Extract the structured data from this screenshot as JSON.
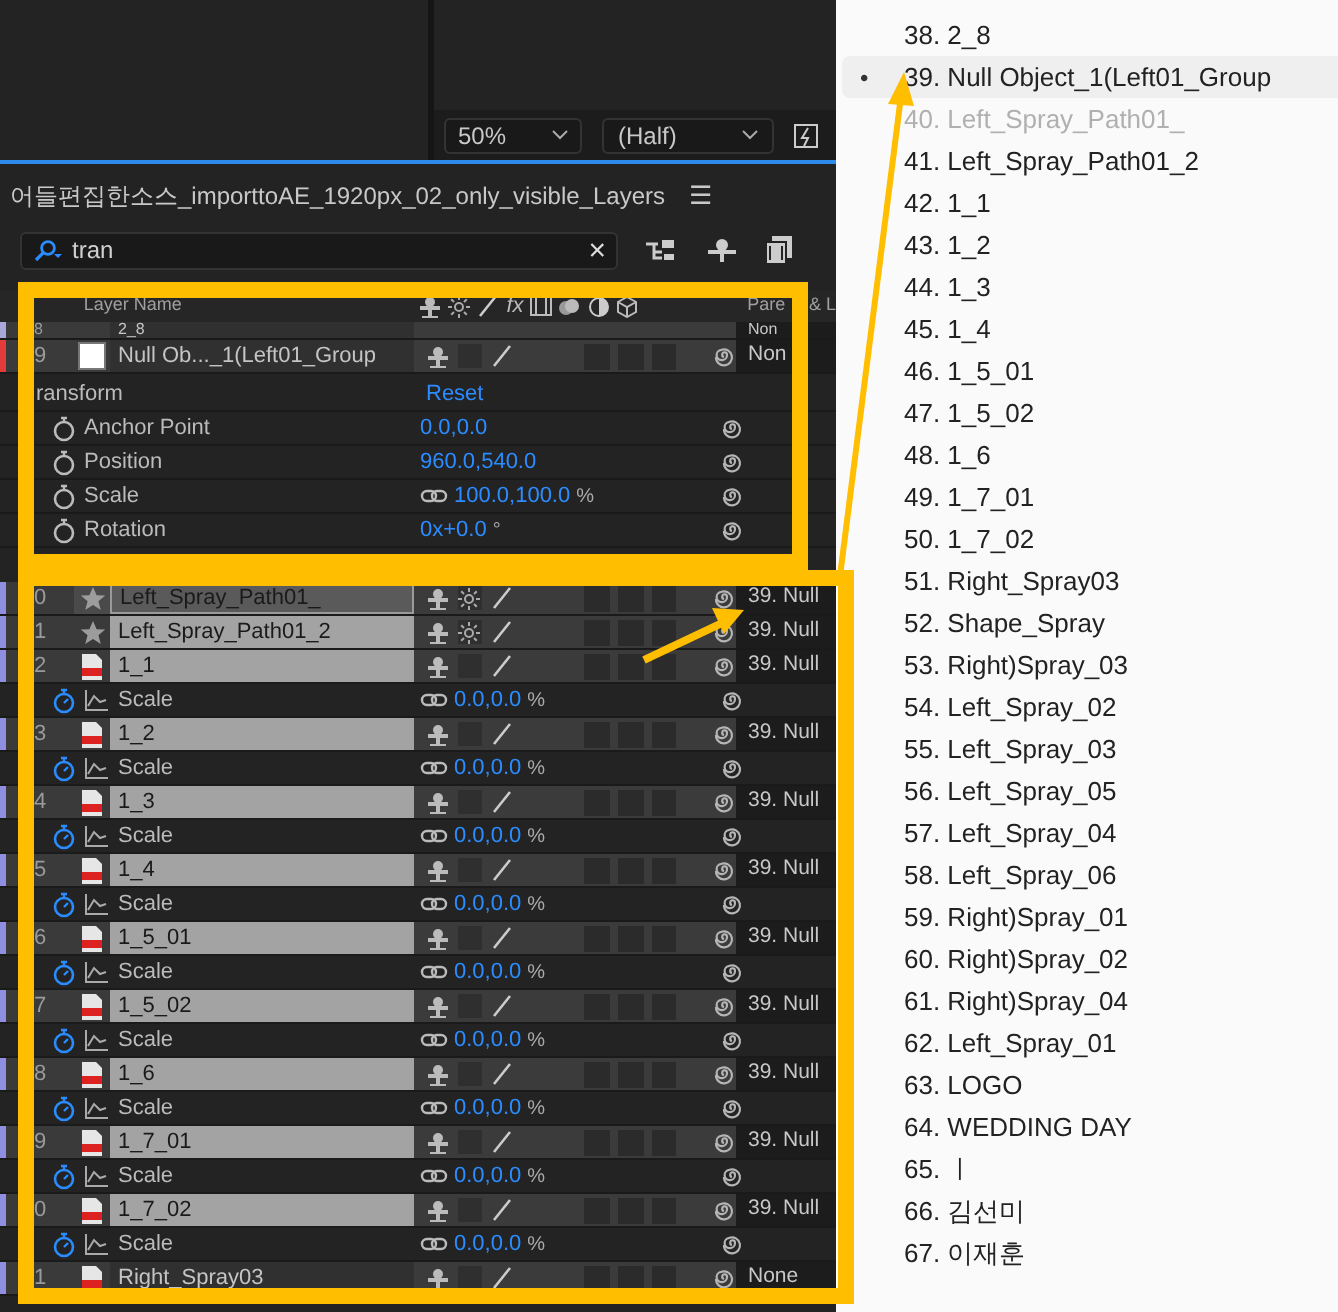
{
  "viewer": {
    "zoom": "50%",
    "resolution": "(Half)"
  },
  "comp_tab": {
    "title": "어들편집한소스_importtoAE_1920px_02_only_visible_Layers",
    "menu": "☰"
  },
  "search": {
    "value": "tran",
    "clear": "×"
  },
  "header": {
    "layer_name": "Layer Name",
    "fx": "fx",
    "parent_left": "Pare",
    "parent_right": "& L"
  },
  "top_rows": [
    {
      "kind": "psd",
      "number": "8",
      "name": "2_8",
      "color": "#a9a9d9",
      "parent": "Non",
      "partial": true,
      "selected": false,
      "matched": false
    },
    {
      "kind": "null",
      "number": "9",
      "name": "Null Ob..._1(Left01_Group",
      "color": "#e33a3a",
      "parent": "Non",
      "partial": false,
      "selected": false,
      "matched": false
    },
    {
      "kind": "group",
      "name": "ransform",
      "value": "Reset"
    },
    {
      "kind": "property",
      "name": "Anchor Point",
      "value": "0.0,0.0",
      "keyframed": false,
      "linked": false
    },
    {
      "kind": "property",
      "name": "Position",
      "value": "960.0,540.0",
      "keyframed": false,
      "linked": false
    },
    {
      "kind": "property",
      "name": "Scale",
      "value": "100.0,100.0",
      "unit": "%",
      "keyframed": false,
      "linked": true
    },
    {
      "kind": "property",
      "name": "Rotation",
      "value": "0x+0.0",
      "unit": "°",
      "keyframed": false,
      "linked": false
    }
  ],
  "layers": [
    {
      "kind": "shape",
      "number": "0",
      "name": "Left_Spray_Path01_",
      "color": "#8f8fe0",
      "parent": "39. Null",
      "partial": false,
      "selected": true,
      "matched": true
    },
    {
      "kind": "shape",
      "number": "1",
      "name": "Left_Spray_Path01_2",
      "color": "#8f8fe0",
      "parent": "39. Null",
      "partial": false,
      "selected": false,
      "matched": true
    },
    {
      "kind": "psd",
      "number": "2",
      "name": "1_1",
      "color": "#8f8fe0",
      "parent": "39. Null",
      "partial": false,
      "selected": false,
      "matched": true
    },
    {
      "kind": "property",
      "name": "Scale",
      "value": "0.0,0.0",
      "unit": "%",
      "keyframed": true,
      "linked": true
    },
    {
      "kind": "psd",
      "number": "3",
      "name": "1_2",
      "color": "#8f8fe0",
      "parent": "39. Null",
      "partial": false,
      "selected": false,
      "matched": true
    },
    {
      "kind": "property",
      "name": "Scale",
      "value": "0.0,0.0",
      "unit": "%",
      "keyframed": true,
      "linked": true
    },
    {
      "kind": "psd",
      "number": "4",
      "name": "1_3",
      "color": "#8f8fe0",
      "parent": "39. Null",
      "partial": false,
      "selected": false,
      "matched": true
    },
    {
      "kind": "property",
      "name": "Scale",
      "value": "0.0,0.0",
      "unit": "%",
      "keyframed": true,
      "linked": true
    },
    {
      "kind": "psd",
      "number": "5",
      "name": "1_4",
      "color": "#8f8fe0",
      "parent": "39. Null",
      "partial": false,
      "selected": false,
      "matched": true
    },
    {
      "kind": "property",
      "name": "Scale",
      "value": "0.0,0.0",
      "unit": "%",
      "keyframed": true,
      "linked": true
    },
    {
      "kind": "psd",
      "number": "6",
      "name": "1_5_01",
      "color": "#8f8fe0",
      "parent": "39. Null",
      "partial": false,
      "selected": false,
      "matched": true
    },
    {
      "kind": "property",
      "name": "Scale",
      "value": "0.0,0.0",
      "unit": "%",
      "keyframed": true,
      "linked": true
    },
    {
      "kind": "psd",
      "number": "7",
      "name": "1_5_02",
      "color": "#8f8fe0",
      "parent": "39. Null",
      "partial": false,
      "selected": false,
      "matched": true
    },
    {
      "kind": "property",
      "name": "Scale",
      "value": "0.0,0.0",
      "unit": "%",
      "keyframed": true,
      "linked": true
    },
    {
      "kind": "psd",
      "number": "8",
      "name": "1_6",
      "color": "#8f8fe0",
      "parent": "39. Null",
      "partial": false,
      "selected": false,
      "matched": true
    },
    {
      "kind": "property",
      "name": "Scale",
      "value": "0.0,0.0",
      "unit": "%",
      "keyframed": true,
      "linked": true
    },
    {
      "kind": "psd",
      "number": "9",
      "name": "1_7_01",
      "color": "#8f8fe0",
      "parent": "39. Null",
      "partial": false,
      "selected": false,
      "matched": true
    },
    {
      "kind": "property",
      "name": "Scale",
      "value": "0.0,0.0",
      "unit": "%",
      "keyframed": true,
      "linked": true
    },
    {
      "kind": "psd",
      "number": "0",
      "name": "1_7_02",
      "color": "#8f8fe0",
      "parent": "39. Null",
      "partial": false,
      "selected": false,
      "matched": true
    },
    {
      "kind": "property",
      "name": "Scale",
      "value": "0.0,0.0",
      "unit": "%",
      "keyframed": true,
      "linked": true
    },
    {
      "kind": "psd",
      "number": "1",
      "name": "Right_Spray03",
      "color": "#8f8fe0",
      "parent": "None",
      "partial": false,
      "selected": false,
      "matched": false
    }
  ],
  "parent_menu": {
    "marker": "•",
    "items": [
      {
        "label": "38. 2_8",
        "selected": false,
        "disabled": false
      },
      {
        "label": "39. Null Object_1(Left01_Group",
        "selected": true,
        "disabled": false
      },
      {
        "label": "40. Left_Spray_Path01_",
        "selected": false,
        "disabled": true
      },
      {
        "label": "41. Left_Spray_Path01_2",
        "selected": false,
        "disabled": false
      },
      {
        "label": "42. 1_1",
        "selected": false,
        "disabled": false
      },
      {
        "label": "43. 1_2",
        "selected": false,
        "disabled": false
      },
      {
        "label": "44. 1_3",
        "selected": false,
        "disabled": false
      },
      {
        "label": "45. 1_4",
        "selected": false,
        "disabled": false
      },
      {
        "label": "46. 1_5_01",
        "selected": false,
        "disabled": false
      },
      {
        "label": "47. 1_5_02",
        "selected": false,
        "disabled": false
      },
      {
        "label": "48. 1_6",
        "selected": false,
        "disabled": false
      },
      {
        "label": "49. 1_7_01",
        "selected": false,
        "disabled": false
      },
      {
        "label": "50. 1_7_02",
        "selected": false,
        "disabled": false
      },
      {
        "label": "51. Right_Spray03",
        "selected": false,
        "disabled": false
      },
      {
        "label": "52. Shape_Spray",
        "selected": false,
        "disabled": false
      },
      {
        "label": "53. Right)Spray_03",
        "selected": false,
        "disabled": false
      },
      {
        "label": "54. Left_Spray_02",
        "selected": false,
        "disabled": false
      },
      {
        "label": "55. Left_Spray_03",
        "selected": false,
        "disabled": false
      },
      {
        "label": "56. Left_Spray_05",
        "selected": false,
        "disabled": false
      },
      {
        "label": "57. Left_Spray_04",
        "selected": false,
        "disabled": false
      },
      {
        "label": "58. Left_Spray_06",
        "selected": false,
        "disabled": false
      },
      {
        "label": "59. Right)Spray_01",
        "selected": false,
        "disabled": false
      },
      {
        "label": "60. Right)Spray_02",
        "selected": false,
        "disabled": false
      },
      {
        "label": "61. Right)Spray_04",
        "selected": false,
        "disabled": false
      },
      {
        "label": "62. Left_Spray_01",
        "selected": false,
        "disabled": false
      },
      {
        "label": "63. LOGO",
        "selected": false,
        "disabled": false
      },
      {
        "label": "64. WEDDING DAY",
        "selected": false,
        "disabled": false
      },
      {
        "label": "65. ㅣ",
        "selected": false,
        "disabled": false
      },
      {
        "label": "66. 김선미",
        "selected": false,
        "disabled": false
      },
      {
        "label": "67. 이재훈",
        "selected": false,
        "disabled": false
      }
    ]
  }
}
